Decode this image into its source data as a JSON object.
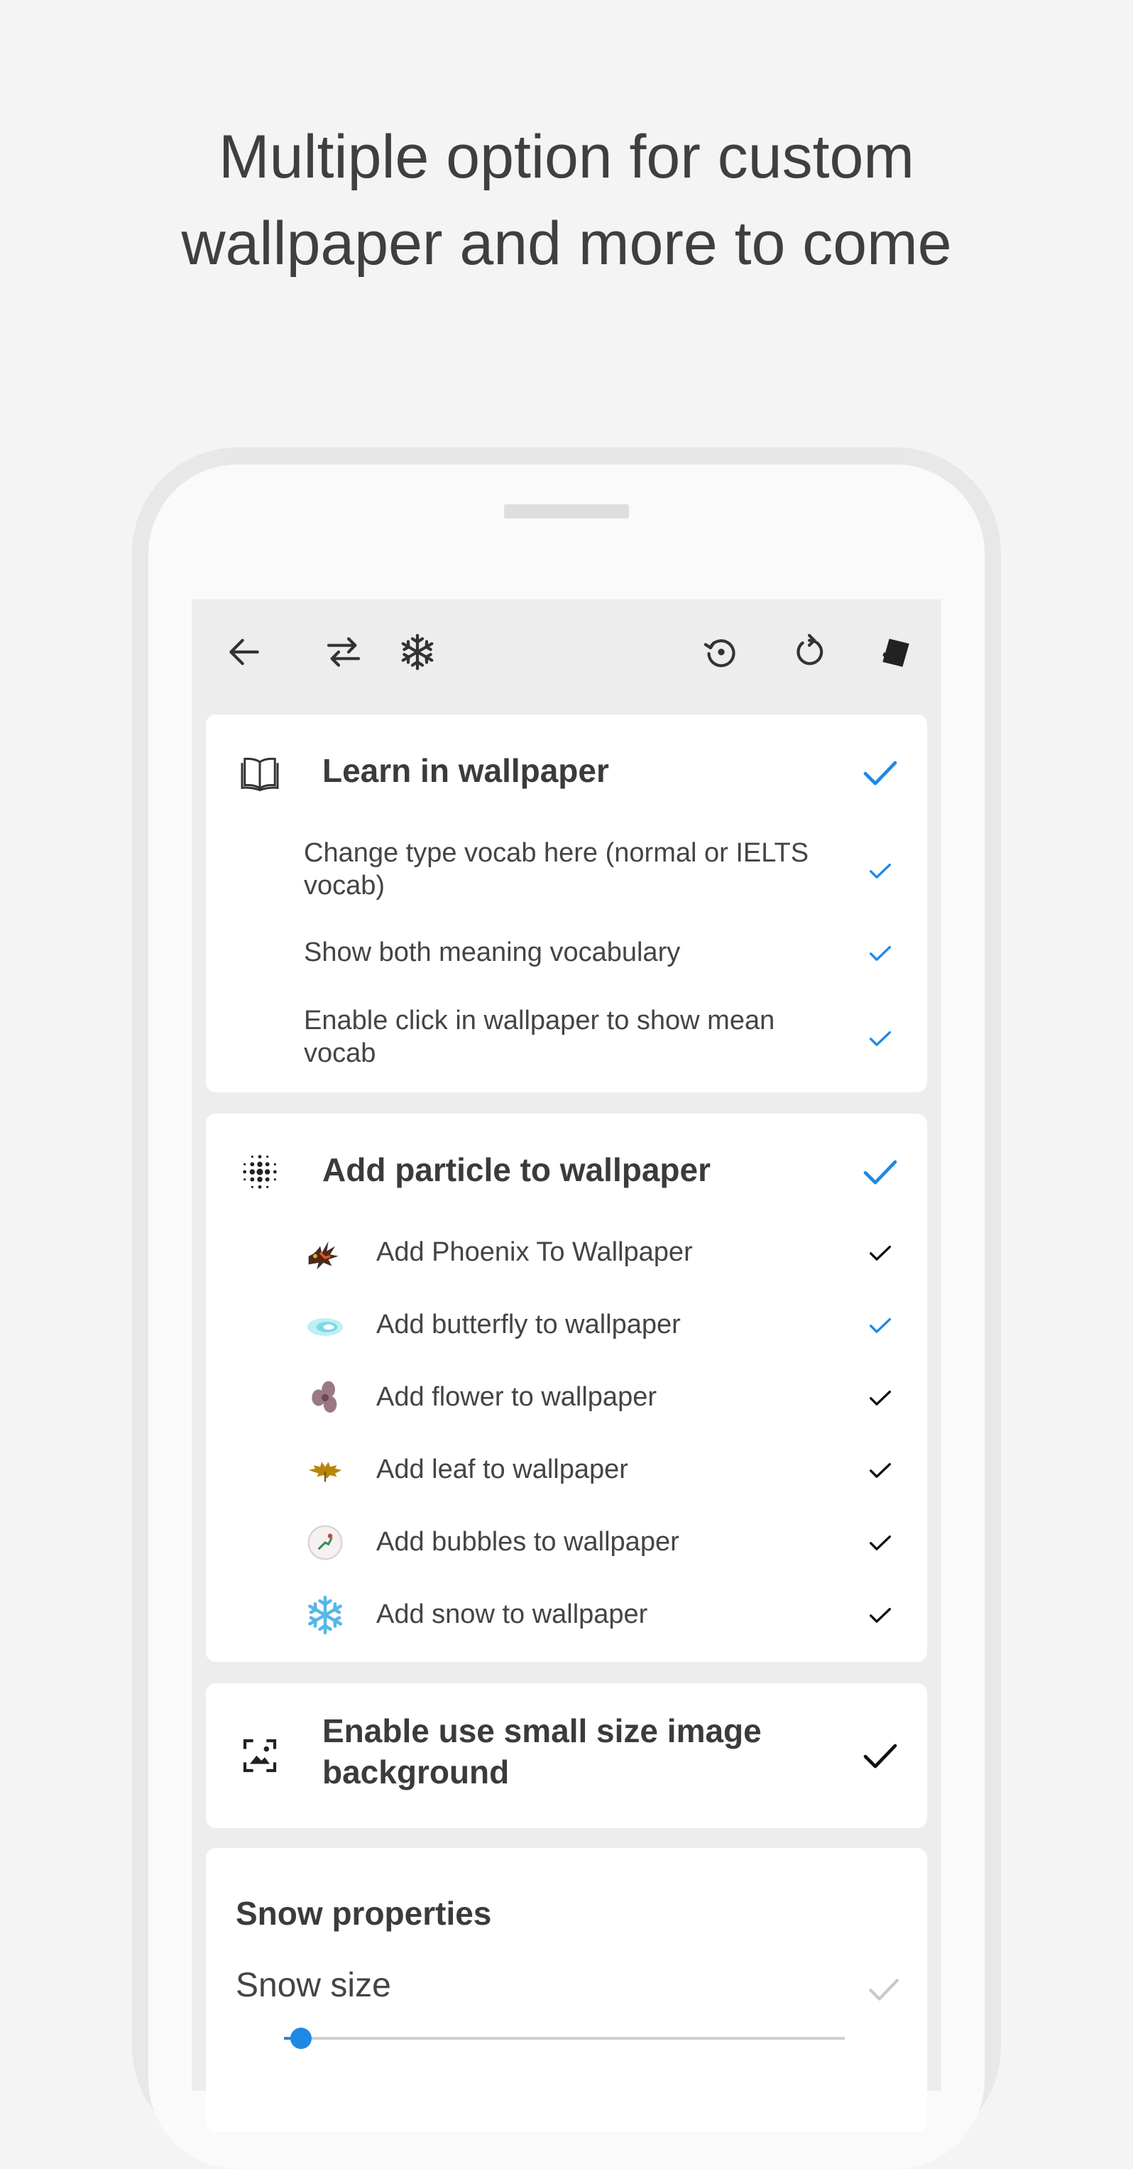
{
  "headline": {
    "line1": "Multiple option for custom",
    "line2": "wallpaper and more to come"
  },
  "toolbar": {
    "icons": [
      "back-arrow-icon",
      "swap-icon",
      "snowflake-icon",
      "restore-icon",
      "refresh-icon",
      "theme-icon"
    ]
  },
  "learn_card": {
    "title": "Learn in wallpaper",
    "icon": "book-icon",
    "enabled": true,
    "items": [
      {
        "label": "Change type vocab here (normal or IELTS vocab)",
        "checked": true
      },
      {
        "label": "Show both meaning vocabulary",
        "checked": true
      },
      {
        "label": "Enable click in wallpaper to show mean vocab",
        "checked": true
      }
    ]
  },
  "particle_card": {
    "title": "Add particle to wallpaper",
    "icon": "particle-dots-icon",
    "enabled": true,
    "items": [
      {
        "label": "Add Phoenix To Wallpaper",
        "icon": "phoenix-icon",
        "check_color": "#111111"
      },
      {
        "label": "Add butterfly to wallpaper",
        "icon": "butterfly-icon",
        "check_color": "#1e88e5"
      },
      {
        "label": "Add flower to wallpaper",
        "icon": "flower-icon",
        "check_color": "#111111"
      },
      {
        "label": "Add leaf to wallpaper",
        "icon": "leaf-icon",
        "check_color": "#111111"
      },
      {
        "label": "Add bubbles to wallpaper",
        "icon": "bubble-icon",
        "check_color": "#111111"
      },
      {
        "label": "Add snow to wallpaper",
        "icon": "snowflake-icon",
        "check_color": "#111111"
      }
    ]
  },
  "small_image_card": {
    "title_line1": "Enable use small size image",
    "title_line2": "background",
    "icon": "image-icon",
    "enabled": true
  },
  "snow_card": {
    "title": "Snow properties",
    "size_label": "Snow size",
    "size_value_fraction": 0.03
  },
  "colors": {
    "accent": "#1e88e5",
    "text": "#3b3b3b",
    "background": "#f4f4f4"
  }
}
